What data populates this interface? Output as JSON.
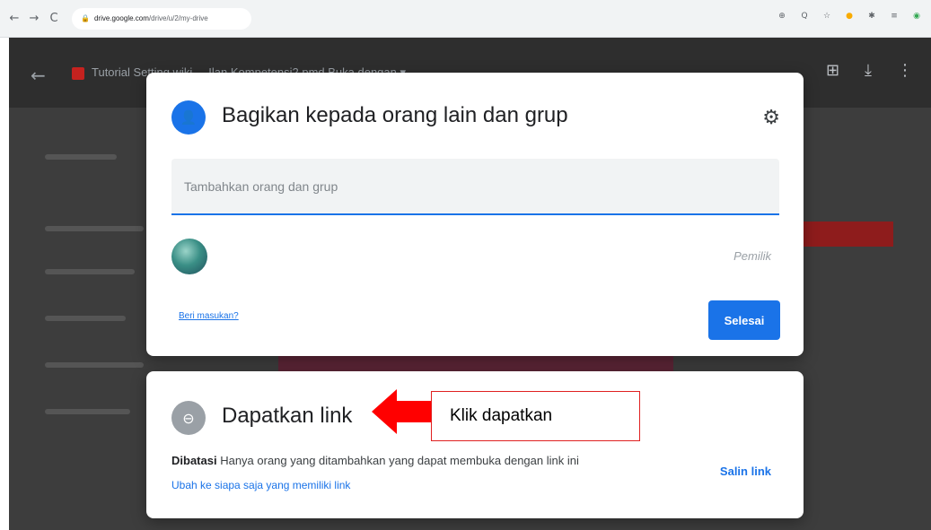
{
  "browser": {
    "back_icon": "←",
    "forward_icon": "→",
    "reload_icon": "C",
    "url_host": "drive.google.com",
    "url_path": "/drive/u/2/my-drive",
    "extension_icons": [
      "⊕",
      "Q",
      "☆",
      "●",
      "✱",
      "≡",
      "◉"
    ]
  },
  "viewer": {
    "doc_title": "Tutorial Setting wiki ... Ilan Kompetensi2.pmd      Buka dengan ▾",
    "back_icon": "←",
    "action_icons": [
      "⊞",
      "⤓",
      "⋮"
    ]
  },
  "share_dialog": {
    "icon": "👤",
    "title": "Bagikan kepada orang lain dan grup",
    "settings_icon": "⚙",
    "add_placeholder": "Tambahkan orang dan grup",
    "owner_label": "Pemilik",
    "feedback_link": "Beri masukan?",
    "done_button": "Selesai"
  },
  "link_card": {
    "icon": "⊖",
    "title": "Dapatkan link",
    "access_level": "Dibatasi",
    "access_description": "Hanya orang yang ditambahkan yang dapat membuka dengan link ini",
    "change_link": "Ubah ke siapa saja yang memiliki link",
    "copy_link": "Salin link"
  },
  "annotation": {
    "text": "Klik dapatkan",
    "color": "#e02020"
  }
}
